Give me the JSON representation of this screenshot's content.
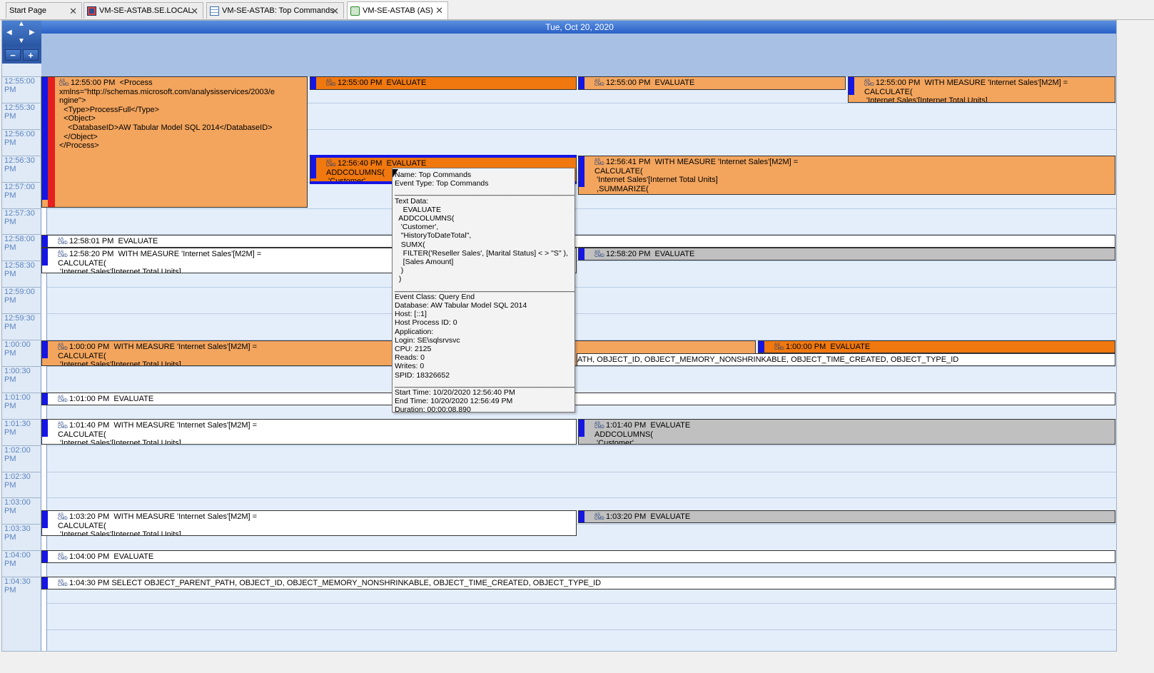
{
  "tabs": [
    {
      "label": "Start Page",
      "icon": "start-page-icon",
      "active": false
    },
    {
      "label": "VM-SE-ASTAB.SE.LOCAL",
      "icon": "server-icon",
      "active": false
    },
    {
      "label": "VM-SE-ASTAB: Top Commands",
      "icon": "table-icon",
      "active": false
    },
    {
      "label": "VM-SE-ASTAB (AS)",
      "icon": "trace-icon",
      "active": true
    }
  ],
  "calendar": {
    "date_header": "Tue, Oct 20, 2020",
    "time_slots": [
      "12:55:00\nPM",
      "12:55:30\nPM",
      "12:56:00\nPM",
      "12:56:30\nPM",
      "12:57:00\nPM",
      "12:57:30\nPM",
      "12:58:00\nPM",
      "12:58:30\nPM",
      "12:59:00\nPM",
      "12:59:30\nPM",
      "1:00:00\nPM",
      "1:00:30\nPM",
      "1:01:00\nPM",
      "1:01:30\nPM",
      "1:02:00\nPM",
      "1:02:30\nPM",
      "1:03:00\nPM",
      "1:03:30\nPM",
      "1:04:00\nPM",
      "1:04:30\nPM"
    ]
  },
  "events": [
    {
      "text": "12:55:00 PM  <Process\nxmlns=\"http://schemas.microsoft.com/analysisservices/2003/e\nngine\">\n  <Type>ProcessFull</Type>\n  <Object>\n    <DatabaseID>AW Tabular Model SQL 2014</DatabaseID>\n  </Object>\n</Process>"
    },
    {
      "text": "12:55:00 PM  EVALUATE"
    },
    {
      "text": "12:55:00 PM  EVALUATE"
    },
    {
      "text": "12:55:00 PM  WITH MEASURE 'Internet Sales'[M2M] =\nCALCULATE(\n 'Internet Sales'[Internet Total Units]"
    },
    {
      "text": "12:56:40 PM  EVALUATE\nADDCOLUMNS(\n 'Customer',"
    },
    {
      "text": "12:56:41 PM  WITH MEASURE 'Internet Sales'[M2M] =\nCALCULATE(\n 'Internet Sales'[Internet Total Units]\n ,SUMMARIZE("
    },
    {
      "text": "12:58:01 PM  EVALUATE"
    },
    {
      "text": "12:58:20 PM  WITH MEASURE 'Internet Sales'[M2M] =\nCALCULATE(\n 'Internet Sales'[Internet Total Units]"
    },
    {
      "text": "12:58:20 PM  EVALUATE"
    },
    {
      "text": "1:00:00 PM  WITH MEASURE 'Internet Sales'[M2M] =\nCALCULATE(\n 'Internet Sales'[Internet Total Units]"
    },
    {
      "text": "1:00:00 PM  EVALUATE"
    },
    {
      "text": "ATH, OBJECT_ID, OBJECT_MEMORY_NONSHRINKABLE, OBJECT_TIME_CREATED, OBJECT_TYPE_ID"
    },
    {
      "text": "1:01:00 PM  EVALUATE"
    },
    {
      "text": "1:01:40 PM  WITH MEASURE 'Internet Sales'[M2M] =\nCALCULATE(\n 'Internet Sales'[Internet Total Units]"
    },
    {
      "text": "1:01:40 PM  EVALUATE\nADDCOLUMNS(\n 'Customer',"
    },
    {
      "text": "1:03:20 PM  WITH MEASURE 'Internet Sales'[M2M] =\nCALCULATE(\n 'Internet Sales'[Internet Total Units]"
    },
    {
      "text": "1:03:20 PM  EVALUATE"
    },
    {
      "text": "1:04:00 PM  EVALUATE"
    },
    {
      "text": "1:04:30 PM SELECT OBJECT_PARENT_PATH, OBJECT_ID, OBJECT_MEMORY_NONSHRINKABLE, OBJECT_TIME_CREATED, OBJECT_TYPE_ID"
    }
  ],
  "tooltip": {
    "text": "Name: Top Commands\nEvent Type: Top Commands\n____________________________________________\nText Data:\n    EVALUATE\n  ADDCOLUMNS(\n   'Customer',\n   \"HistoryToDateTotal\",\n   SUMX(\n    FILTER('Reseller Sales', [Marital Status] < > \"S\" ),\n    [Sales Amount]\n   )\n  )\n____________________________________________\nEvent Class: Query End\nDatabase: AW Tabular Model SQL 2014\nHost: [::1]\nHost Process ID: 0\nApplication:\nLogin: SE\\sqlsrvsvc\nCPU: 2125\nReads: 0\nWrites: 0\nSPID: 18326652\n____________________________________________\nStart Time: 10/20/2020 12:56:40 PM\nEnd Time: 10/20/2020 12:56:49 PM\nDuration: 00:00:08.890"
  },
  "colors": {
    "accent": "#2960c6",
    "orange": "#f3a55e",
    "orange_dark": "#f0780f",
    "gray": "#c0c0c0",
    "blue_bar": "#1515e6",
    "red_bar": "#e52020"
  }
}
